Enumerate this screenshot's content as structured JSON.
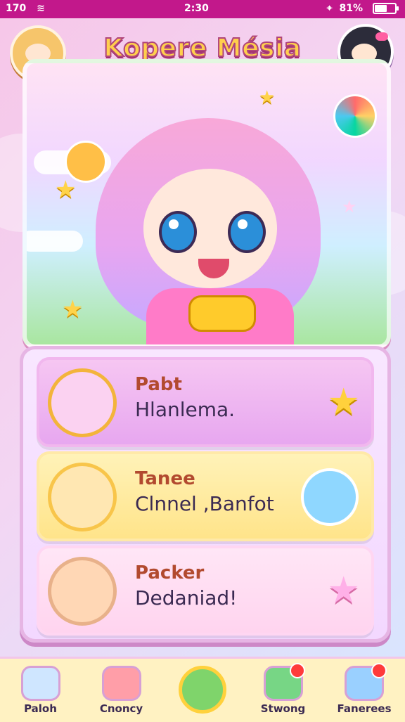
{
  "statusbar": {
    "left": "170",
    "time": "2:30",
    "right": "81%",
    "battery_level": 0.65
  },
  "header": {
    "title": "Kopere Mésia"
  },
  "cards": [
    {
      "kicker": "Pabt",
      "text": "Hlanlema."
    },
    {
      "kicker": "Tanee",
      "text": "Clnnel ,Banfot"
    },
    {
      "kicker": "Packer",
      "text": "Dedaniad!"
    }
  ],
  "bottom_nav": [
    {
      "label": "Paloh",
      "icon": "home-icon"
    },
    {
      "label": "Cnoncy",
      "icon": "heart-icon"
    },
    {
      "label": "",
      "icon": "center-action-icon"
    },
    {
      "label": "Stwong",
      "icon": "mail-icon"
    },
    {
      "label": "Fanerees",
      "icon": "chat-icon"
    }
  ]
}
